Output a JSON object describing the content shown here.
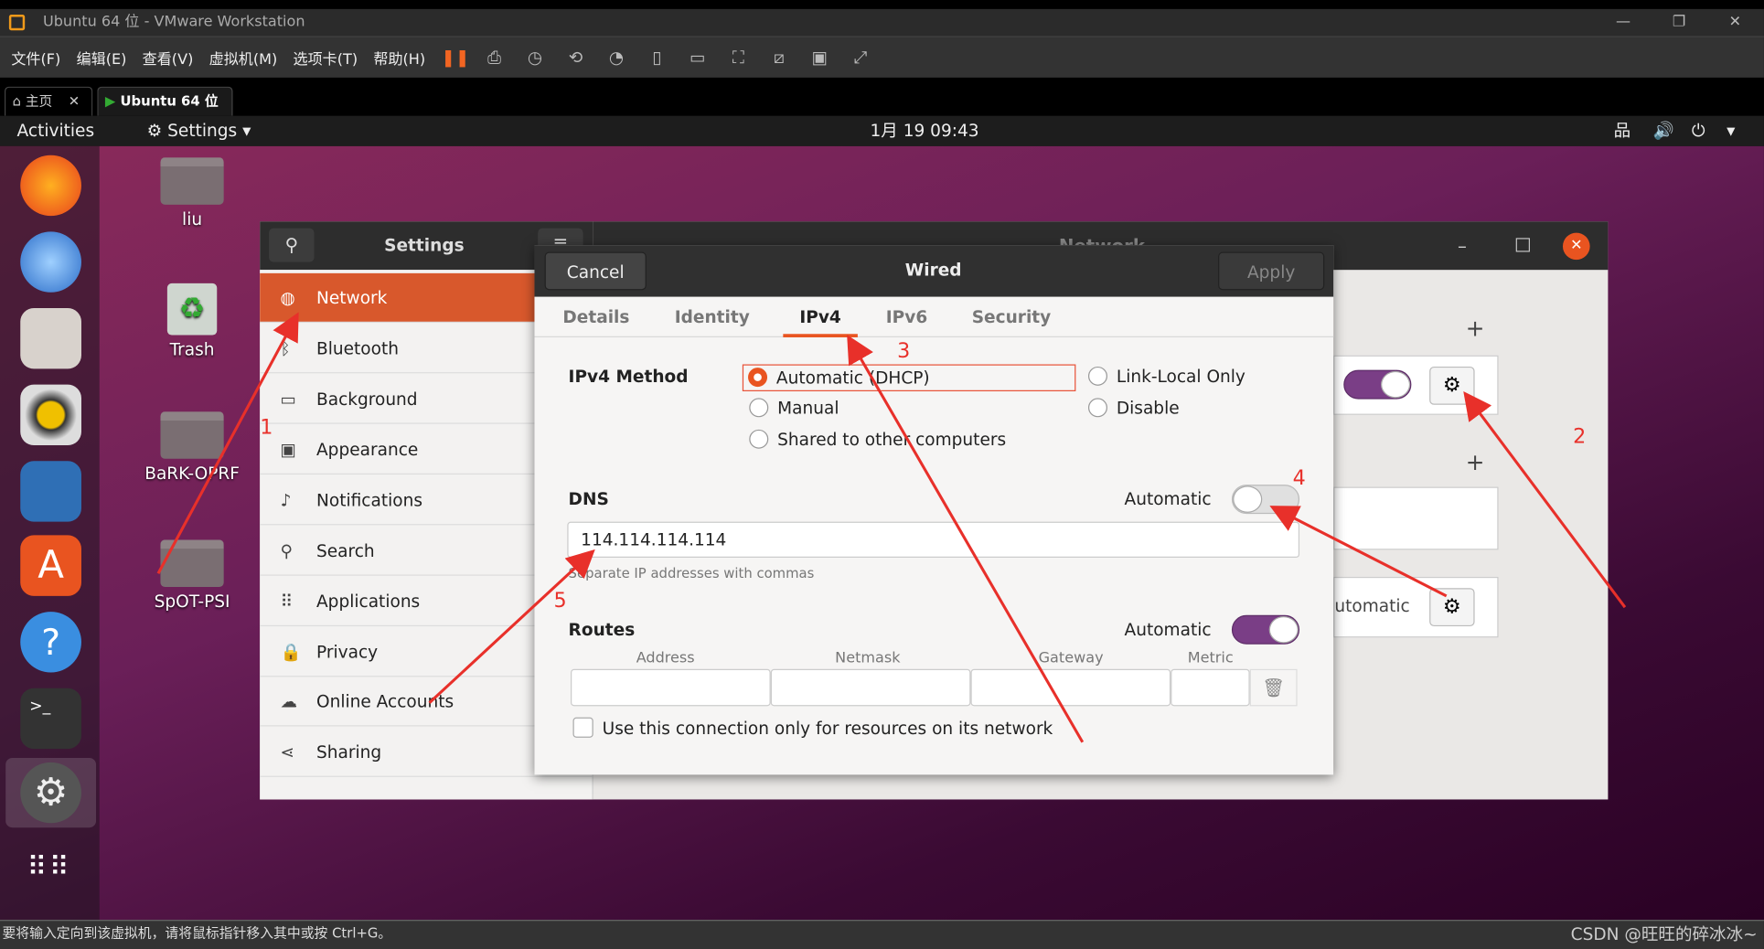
{
  "vmware": {
    "title": "Ubuntu 64 位 - VMware Workstation",
    "menu": [
      "文件(F)",
      "编辑(E)",
      "查看(V)",
      "虚拟机(M)",
      "选项卡(T)",
      "帮助(H)"
    ],
    "tabs": [
      {
        "label": "主页"
      },
      {
        "label": "Ubuntu 64 位"
      }
    ],
    "status": "要将输入定向到该虚拟机，请将鼠标指针移入其中或按 Ctrl+G。",
    "watermark": "CSDN @旺旺的碎冰冰~"
  },
  "topbar": {
    "activities": "Activities",
    "app": "Settings",
    "clock": "1月 19  09:43"
  },
  "desktop": {
    "icons": [
      "liu",
      "Trash",
      "BaRK-OPRF",
      "SpOT-PSI"
    ]
  },
  "settings": {
    "title": "Settings",
    "panel_title": "Network",
    "sidebar": [
      {
        "label": "Network",
        "icon": "network-icon"
      },
      {
        "label": "Bluetooth",
        "icon": "bluetooth-icon"
      },
      {
        "label": "Background",
        "icon": "background-icon"
      },
      {
        "label": "Appearance",
        "icon": "appearance-icon"
      },
      {
        "label": "Notifications",
        "icon": "bell-icon"
      },
      {
        "label": "Search",
        "icon": "search-icon"
      },
      {
        "label": "Applications",
        "icon": "grid-icon"
      },
      {
        "label": "Privacy",
        "icon": "lock-icon"
      },
      {
        "label": "Online Accounts",
        "icon": "cloud-icon"
      },
      {
        "label": "Sharing",
        "icon": "share-icon"
      }
    ],
    "proxy_partial": "utomatic"
  },
  "dialog": {
    "title": "Wired",
    "cancel": "Cancel",
    "apply": "Apply",
    "tabs": [
      "Details",
      "Identity",
      "IPv4",
      "IPv6",
      "Security"
    ],
    "active_tab": "IPv4",
    "ipv4_method_label": "IPv4 Method",
    "methods": {
      "auto": "Automatic (DHCP)",
      "link_local": "Link-Local Only",
      "manual": "Manual",
      "disable": "Disable",
      "shared": "Shared to other computers"
    },
    "selected_method": "Automatic (DHCP)",
    "dns_label": "DNS",
    "dns_automatic_label": "Automatic",
    "dns_automatic": false,
    "dns_value": "114.114.114.114",
    "dns_hint": "Separate IP addresses with commas",
    "routes_label": "Routes",
    "routes_automatic_label": "Automatic",
    "routes_automatic": true,
    "route_columns": [
      "Address",
      "Netmask",
      "Gateway",
      "Metric"
    ],
    "only_local_label": "Use this connection only for resources on its network",
    "only_local": false
  },
  "annotations": [
    "1",
    "2",
    "3",
    "4",
    "5"
  ],
  "colors": {
    "accent": "#e95420",
    "toggle_on": "#7a3e86",
    "annotation": "#e8302a"
  }
}
